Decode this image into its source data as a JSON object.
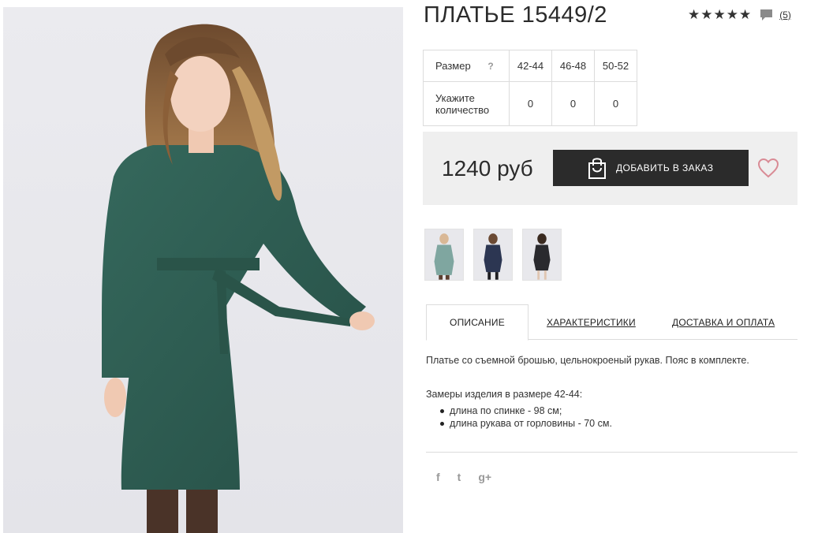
{
  "product": {
    "title": "ПЛАТЬЕ 15449/2",
    "stars": "★★★★★",
    "reviews_count": "(5)",
    "icons": {
      "rating": "star-icon",
      "comments": "comment-icon"
    }
  },
  "size_table": {
    "size_label": "Размер",
    "help_mark": "?",
    "sizes": [
      "42-44",
      "46-48",
      "50-52"
    ],
    "qty_label_line1": "Укажите",
    "qty_label_line2": "количество",
    "quantities": [
      "0",
      "0",
      "0"
    ]
  },
  "order": {
    "price": "1240 руб",
    "add_button_label": "ДОБАВИТЬ В ЗАКАЗ",
    "icons": {
      "button": "shopping-bag-icon",
      "wishlist": "heart-icon"
    },
    "colors": {
      "button_bg": "#2b2b2b",
      "heart": "#d98b95",
      "box_bg": "#efefef"
    }
  },
  "thumbnails": [
    {
      "name": "thumb-green-dress"
    },
    {
      "name": "thumb-navy-dress"
    },
    {
      "name": "thumb-black-dress"
    }
  ],
  "tabs": [
    {
      "label": "ОПИСАНИЕ",
      "active": true
    },
    {
      "label": "ХАРАКТЕРИСТИКИ",
      "active": false
    },
    {
      "label": "ДОСТАВКА И ОПЛАТА",
      "active": false
    }
  ],
  "description": {
    "text": "Платье со съемной брошью, цельнокроеный рукав. Пояс в комплекте.",
    "measurements_title": "Замеры изделия в размере 42-44:",
    "measurements": [
      "длина по спинке - 98 см;",
      "длина рукава от горловины - 70 см."
    ]
  },
  "social": {
    "facebook": "f",
    "twitter": "t",
    "google_plus": "g+"
  },
  "colors": {
    "dress": "#2e5d52",
    "background": "#ffffff",
    "text": "#2b2b2b"
  }
}
